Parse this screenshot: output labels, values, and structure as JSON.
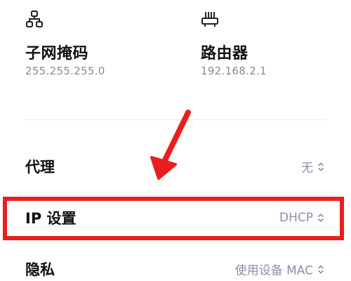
{
  "network_info": {
    "subnet": {
      "title": "子网掩码",
      "value": "255.255.255.0",
      "icon": "network-nodes-icon"
    },
    "router": {
      "title": "路由器",
      "value": "192.168.2.1",
      "icon": "router-icon"
    }
  },
  "settings": {
    "proxy": {
      "label": "代理",
      "value": "无"
    },
    "ip": {
      "label": "IP 设置",
      "value": "DHCP"
    },
    "privacy": {
      "label": "隐私",
      "value": "使用设备 MAC"
    }
  },
  "annotation": {
    "color": "#ee1d1d"
  },
  "colors": {
    "value_text": "#8a8fa8",
    "secondary_text": "#8a8a8a"
  }
}
